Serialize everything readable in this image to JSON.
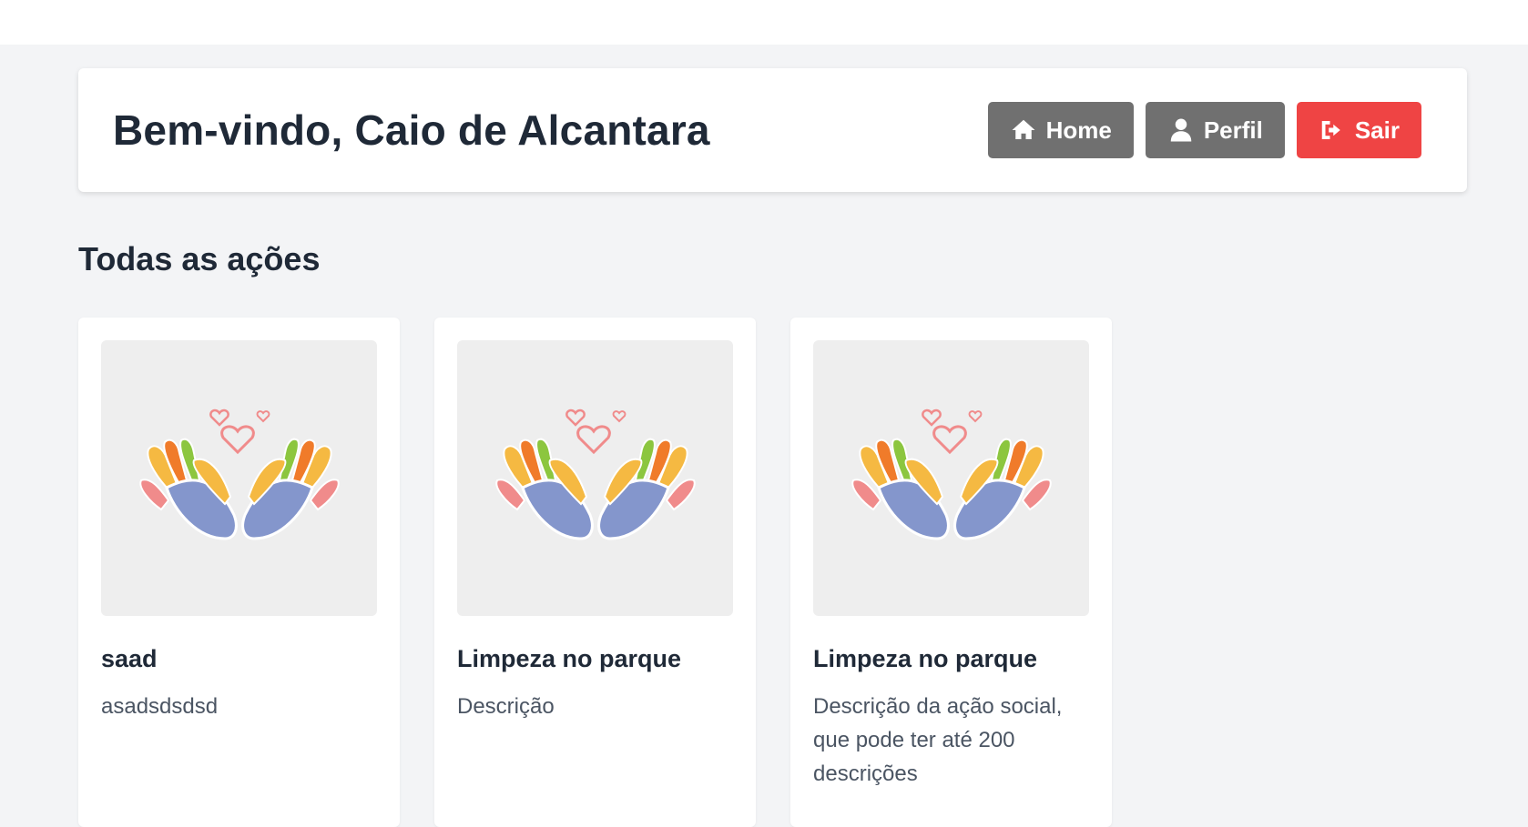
{
  "header": {
    "welcome": "Bem-vindo, Caio de Alcantara",
    "nav": [
      {
        "label": "Home",
        "icon": "home-icon",
        "color": "#707070"
      },
      {
        "label": "Perfil",
        "icon": "user-icon",
        "color": "#707070"
      },
      {
        "label": "Sair",
        "icon": "sign-out-icon",
        "color": "#ef4444"
      }
    ]
  },
  "main": {
    "section_title": "Todas as ações",
    "cards": [
      {
        "title": "saad",
        "description": "asadsdsdsd",
        "image": "caring-hands-hearts-image"
      },
      {
        "title": "Limpeza no parque",
        "description": "Descrição",
        "image": "caring-hands-hearts-image"
      },
      {
        "title": "Limpeza no parque",
        "description": "Descrição da ação social, que pode ter até 200 descrições",
        "image": "caring-hands-hearts-image"
      }
    ]
  },
  "colors": {
    "background": "#f3f4f6",
    "danger": "#ef4444",
    "secondary": "#707070",
    "text": "#1f2937"
  }
}
